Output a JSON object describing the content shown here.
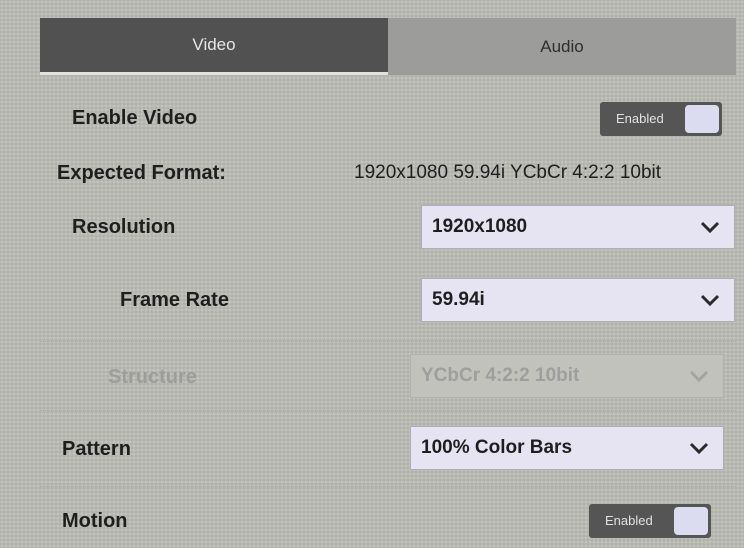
{
  "tabs": {
    "video": "Video",
    "audio": "Audio"
  },
  "enable_video": {
    "label": "Enable Video",
    "toggle_text": "Enabled"
  },
  "expected_format": {
    "label": "Expected Format:",
    "value": "1920x1080 59.94i YCbCr 4:2:2 10bit"
  },
  "resolution": {
    "label": "Resolution",
    "value": "1920x1080"
  },
  "frame_rate": {
    "label": "Frame Rate",
    "value": "59.94i"
  },
  "structure": {
    "label": "Structure",
    "value": "YCbCr 4:2:2 10bit"
  },
  "pattern": {
    "label": "Pattern",
    "value": "100% Color Bars"
  },
  "motion": {
    "label": "Motion",
    "toggle_text": "Enabled"
  },
  "icons": {
    "dropdown": "chevron-down-icon"
  },
  "colors": {
    "active_tab": "#515151",
    "inactive_tab": "#9c9c9a",
    "select_background": "#e6e4f2",
    "toggle_background": "#555555"
  }
}
